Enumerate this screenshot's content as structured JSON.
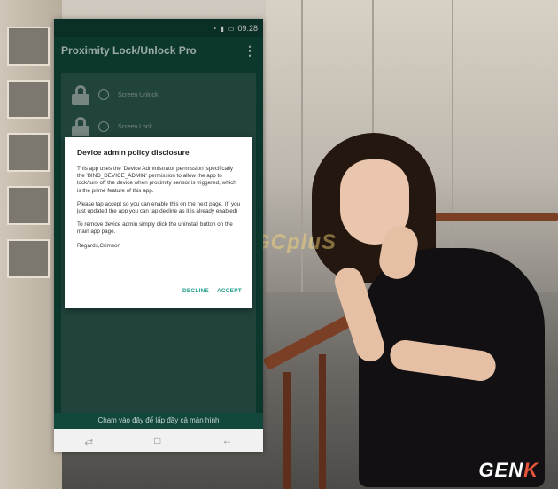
{
  "status_bar": {
    "time": "09:28",
    "icons": [
      "wifi-icon",
      "signal-icon",
      "battery-icon"
    ]
  },
  "app_bar": {
    "title": "Proximity Lock/Unlock Pro",
    "menu_icon": "more-vert-icon"
  },
  "options": [
    {
      "label": "Screen Unlock",
      "icon": "lock-icon"
    },
    {
      "label": "Screen Lock",
      "icon": "lock-icon"
    }
  ],
  "dialog": {
    "title": "Device admin policy disclosure",
    "paragraph1": "This app uses the 'Device Administrator permission' specifically the 'BIND_DEVICE_ADMIN' permission to allow the app to lock/turn off the device when proximity sensor is triggered, which is the prime feature of this app.",
    "paragraph2": "Please tap accept so you can enable this on the next page. (If you just updated the app you can tap decline as it is already enabled)",
    "paragraph3": "To remove device admin simply click the uninstall button on the main app page.",
    "paragraph4": "Regards,Crimson",
    "decline_label": "DECLINE",
    "accept_label": "ACCEPT"
  },
  "fill_hint": "Chạm vào đây để lấp đầy cả màn hình",
  "nav_bar": {
    "recents": "⥄",
    "home": "□",
    "back": "←"
  },
  "watermark_center": "GCpluS",
  "brand_watermark": {
    "main": "GEN",
    "accent": "K"
  },
  "colors": {
    "app_primary": "#0f4a3c",
    "accent": "#1e9c8a"
  }
}
